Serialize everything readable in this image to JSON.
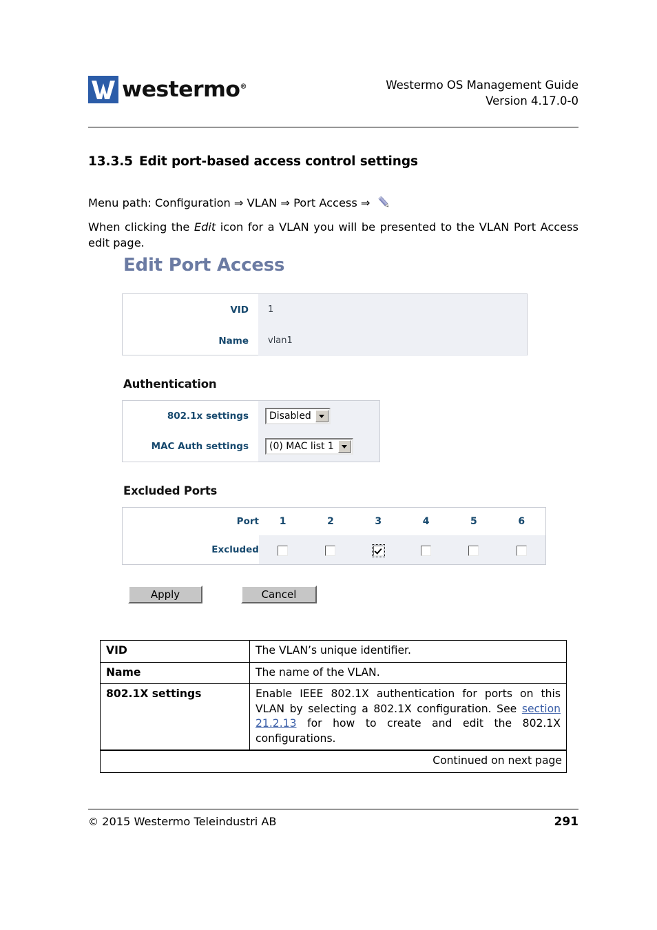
{
  "header": {
    "logo_word": "westermo",
    "logo_registered": "®",
    "logo_icon": "westermo-w-logo",
    "doc_title_line1": "Westermo OS Management Guide",
    "doc_title_line2": "Version 4.17.0-0"
  },
  "section": {
    "number": "13.3.5",
    "title": "Edit port-based access control settings",
    "menu_path_prefix": "Menu path: Configuration ⇒ VLAN ⇒ Port Access ⇒",
    "menu_path_icon": "pencil-edit-icon",
    "intro_before_em": "When clicking the ",
    "intro_em": "Edit",
    "intro_after_em": " icon for a VLAN you will be presented to the VLAN Port Access edit page."
  },
  "app": {
    "title": "Edit Port Access",
    "identity": {
      "rows": [
        {
          "label": "VID",
          "value": "1"
        },
        {
          "label": "Name",
          "value": "vlan1"
        }
      ]
    },
    "authentication": {
      "heading": "Authentication",
      "rows": [
        {
          "label": "802.1x settings",
          "selected": "Disabled"
        },
        {
          "label": "MAC Auth settings",
          "selected": "(0) MAC list 1"
        }
      ]
    },
    "excluded_ports": {
      "heading": "Excluded Ports",
      "port_header_label": "Port",
      "row_label": "Excluded",
      "ports": [
        "1",
        "2",
        "3",
        "4",
        "5",
        "6"
      ],
      "checked": [
        false,
        false,
        true,
        false,
        false,
        false
      ],
      "focused_index": 2
    },
    "buttons": {
      "apply": "Apply",
      "cancel": "Cancel"
    }
  },
  "doc_table": {
    "rows": [
      {
        "term": "VID",
        "desc": "The VLAN’s unique identifier."
      },
      {
        "term": "Name",
        "desc": "The name of the VLAN."
      },
      {
        "term": "802.1X settings",
        "desc_part1": "Enable IEEE 802.1X authentication for ports on this VLAN by selecting a 802.1X configuration. See ",
        "desc_link": "section 21.2.13",
        "desc_part2": " for how to create and edit the 802.1X configurations."
      }
    ],
    "continued": "Continued on next page",
    "link_color": "#3b5fa8"
  },
  "footer": {
    "copyright_glyph": "©",
    "copyright": "2015 Westermo Teleindustri AB",
    "page_number": "291"
  }
}
